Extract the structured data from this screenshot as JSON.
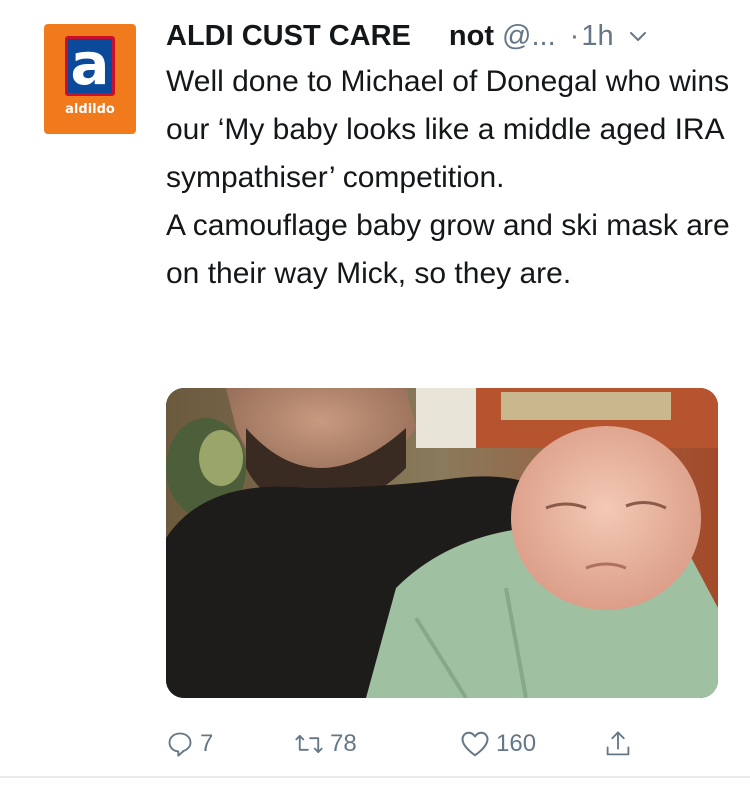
{
  "tweet": {
    "author": {
      "display_name": "ALDI CUST CARE",
      "handle_prefix": "not",
      "handle_rest": " @...",
      "avatar": {
        "letter": "a",
        "wordmark": "aldildo"
      }
    },
    "time_separator": "·",
    "timestamp": "1h",
    "text_lines": [
      "Well done to Michael of Donegal who wins our ‘My baby looks like a middle aged IRA sympathiser’ competition.",
      "A camouflage baby grow and ski mask are on their way Mick, so they are."
    ],
    "media": {
      "icon": "photo-icon"
    },
    "actions": {
      "replies": "7",
      "retweets": "78",
      "likes": "160"
    }
  },
  "colors": {
    "text": "#14171a",
    "muted": "#657786",
    "avatar_orange": "#f07a1c",
    "logo_blue": "#0b4a9a",
    "logo_red": "#c8102e"
  }
}
